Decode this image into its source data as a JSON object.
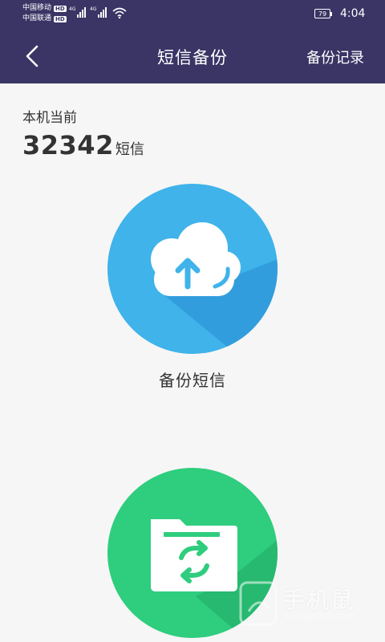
{
  "status_bar": {
    "carrier1": "中国移动",
    "carrier2": "中国联通",
    "hd_badge": "HD",
    "network_tag": "4G",
    "battery": "79",
    "time": "4:04"
  },
  "app_bar": {
    "title": "短信备份",
    "records_label": "备份记录"
  },
  "summary": {
    "label": "本机当前",
    "count": "32342",
    "unit": "短信"
  },
  "actions": {
    "backup_label": "备份短信"
  },
  "watermark": {
    "text": "手机鼠",
    "sub": "SHOUJISHU.COM"
  },
  "colors": {
    "header_bg": "#3a3565",
    "backup_blue": "#3fb3ea",
    "restore_green": "#2fcd7e",
    "background": "#f6f6f6"
  },
  "icons": [
    "back-arrow-icon",
    "cloud-upload-icon",
    "folder-sync-icon",
    "wifi-icon",
    "signal-icon",
    "battery-icon"
  ]
}
